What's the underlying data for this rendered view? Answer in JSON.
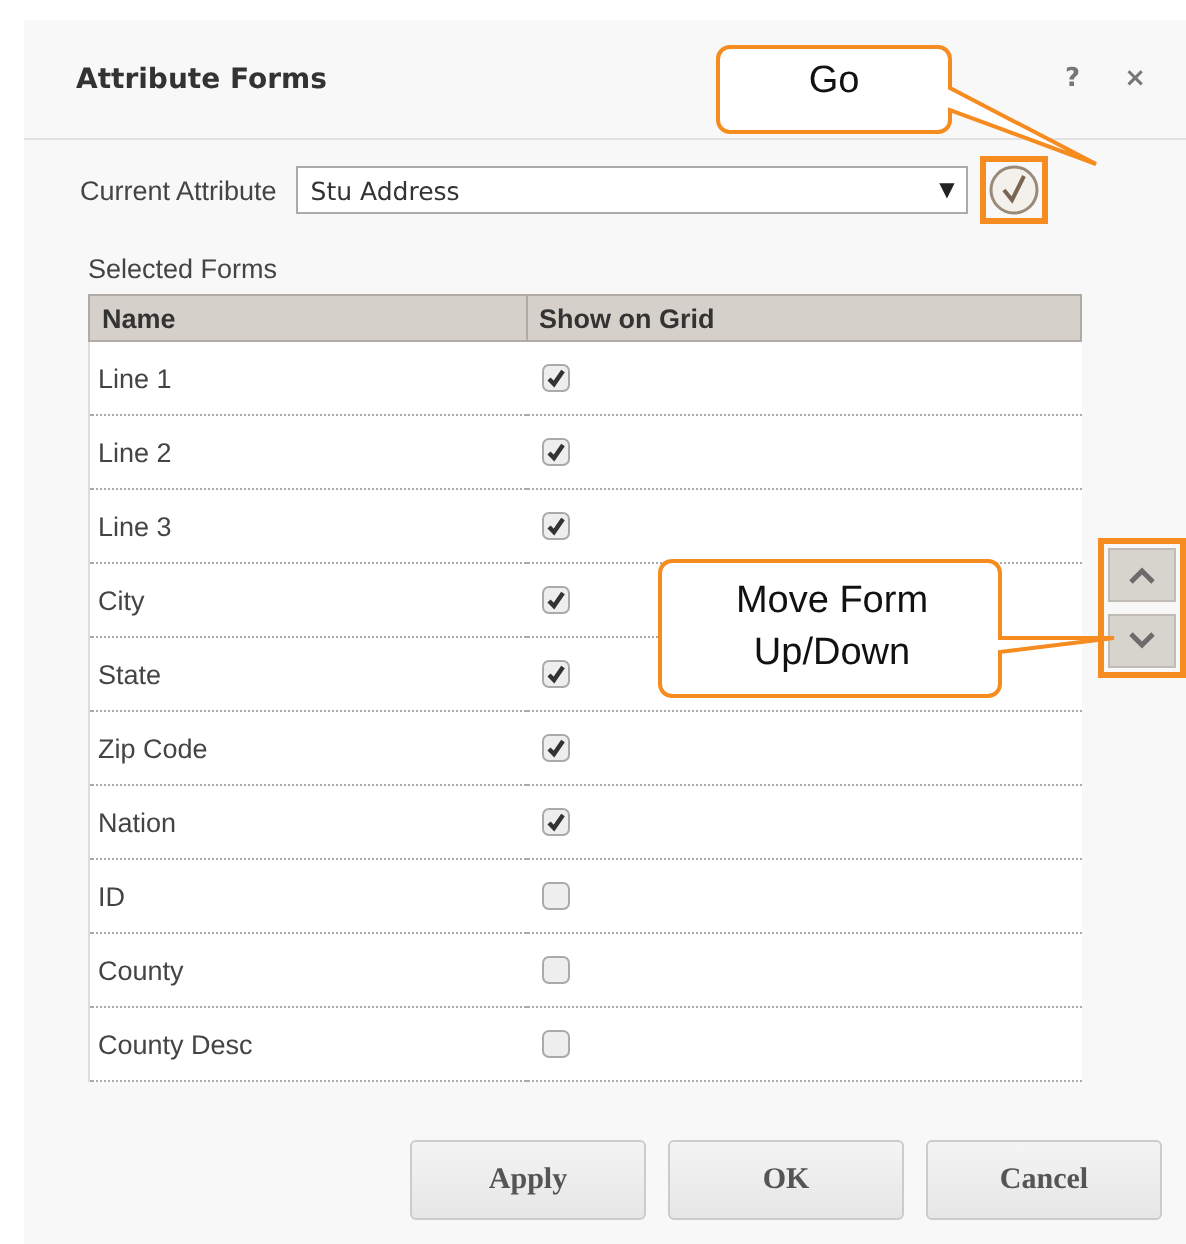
{
  "dialog": {
    "title": "Attribute Forms",
    "help": "?",
    "close": "×"
  },
  "current_attribute": {
    "label": "Current Attribute",
    "value": "Stu Address",
    "arrow": "▼"
  },
  "selected_forms": {
    "label": "Selected Forms",
    "columns": [
      "Name",
      "Show on Grid"
    ],
    "rows": [
      {
        "name": "Line 1",
        "show_on_grid": true
      },
      {
        "name": "Line 2",
        "show_on_grid": true
      },
      {
        "name": "Line 3",
        "show_on_grid": true
      },
      {
        "name": "City",
        "show_on_grid": true
      },
      {
        "name": "State",
        "show_on_grid": true
      },
      {
        "name": "Zip Code",
        "show_on_grid": true
      },
      {
        "name": "Nation",
        "show_on_grid": true
      },
      {
        "name": "ID",
        "show_on_grid": false
      },
      {
        "name": "County",
        "show_on_grid": false
      },
      {
        "name": "County Desc",
        "show_on_grid": false
      }
    ]
  },
  "buttons": [
    "Apply",
    "OK",
    "Cancel"
  ],
  "callouts": [
    {
      "kind": "go",
      "text": "Go"
    },
    {
      "kind": "move",
      "text": "Move Form Up/Down"
    }
  ]
}
